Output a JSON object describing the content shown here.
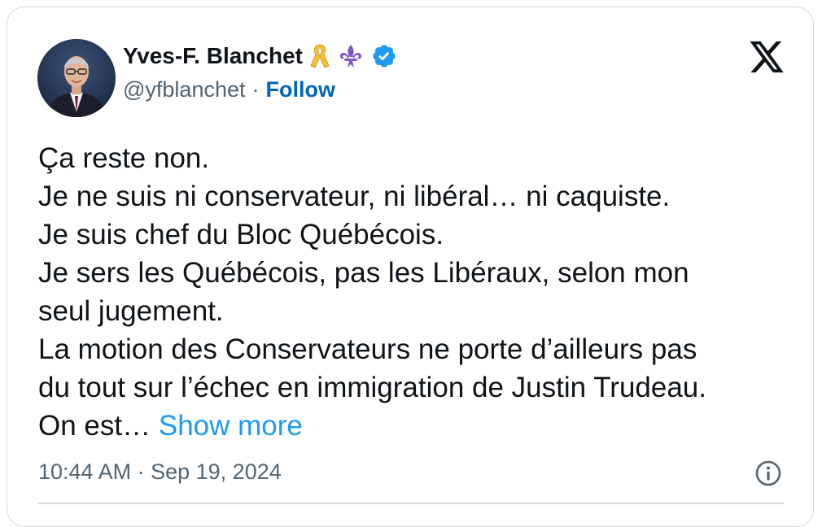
{
  "author": {
    "name": "Yves-F. Blanchet",
    "handle": "@yfblanchet",
    "separator": "·",
    "follow_label": "Follow",
    "badges": [
      "yellow-ribbon-icon",
      "fleur-de-lis-icon",
      "verified-badge-icon"
    ]
  },
  "tweet": {
    "lines": [
      "Ça reste non.",
      "Je ne suis ni conservateur, ni libéral… ni caquiste.",
      "Je suis chef du Bloc Québécois.",
      "Je sers les Québécois, pas les Libéraux, selon mon",
      "seul jugement.",
      "La motion des Conservateurs ne porte d’ailleurs pas",
      "du tout sur l’échec en immigration de Justin Trudeau.",
      "On est…"
    ],
    "show_more_label": "Show more"
  },
  "meta": {
    "time": "10:44 AM",
    "separator": "·",
    "date": "Sep 19, 2024"
  },
  "colors": {
    "text": "#0f1419",
    "secondary": "#536471",
    "follow": "#0067b8",
    "link": "#1d9bf0",
    "border": "#cfd9de",
    "verified": "#1d9bf0"
  }
}
